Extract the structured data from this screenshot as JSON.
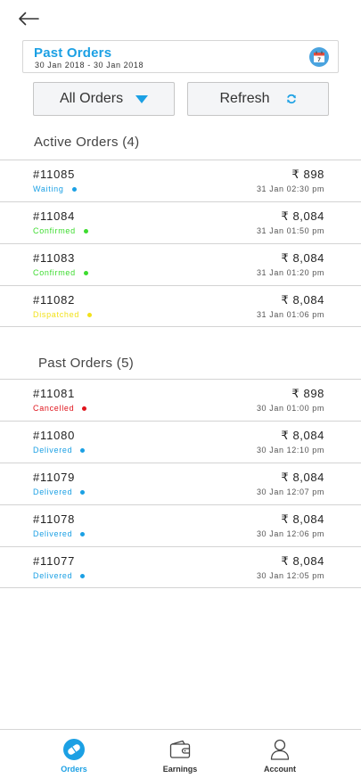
{
  "header": {
    "back_icon": "arrow-left-icon"
  },
  "date_filter": {
    "title": "Past Orders",
    "range": "30 Jan 2018 - 30 Jan 2018",
    "calendar_icon": "calendar-icon",
    "calendar_day": "7"
  },
  "controls": {
    "filter_label": "All Orders",
    "refresh_label": "Refresh"
  },
  "active_section": {
    "title": "Active Orders (4)",
    "orders": [
      {
        "id": "#11085",
        "status": "Waiting",
        "status_color": "#1ba0e4",
        "amount": "₹ 898",
        "time": "31 Jan 02:30 pm"
      },
      {
        "id": "#11084",
        "status": "Confirmed",
        "status_color": "#3ddc2f",
        "amount": "₹ 8,084",
        "time": "31 Jan 01:50 pm"
      },
      {
        "id": "#11083",
        "status": "Confirmed",
        "status_color": "#3ddc2f",
        "amount": "₹ 8,084",
        "time": "31 Jan 01:20 pm"
      },
      {
        "id": "#11082",
        "status": "Dispatched",
        "status_color": "#f2e11b",
        "amount": "₹ 8,084",
        "time": "31 Jan 01:06 pm"
      }
    ]
  },
  "past_section": {
    "title": "Past Orders (5)",
    "orders": [
      {
        "id": "#11081",
        "status": "Cancelled",
        "status_color": "#e0141c",
        "amount": "₹ 898",
        "time": "30 Jan 01:00 pm"
      },
      {
        "id": "#11080",
        "status": "Delivered",
        "status_color": "#1ba0e4",
        "amount": "₹ 8,084",
        "time": "30 Jan 12:10 pm"
      },
      {
        "id": "#11079",
        "status": "Delivered",
        "status_color": "#1ba0e4",
        "amount": "₹ 8,084",
        "time": "30 Jan 12:07 pm"
      },
      {
        "id": "#11078",
        "status": "Delivered",
        "status_color": "#1ba0e4",
        "amount": "₹ 8,084",
        "time": "30 Jan 12:06 pm"
      },
      {
        "id": "#11077",
        "status": "Delivered",
        "status_color": "#1ba0e4",
        "amount": "₹ 8,084",
        "time": "30 Jan 12:05 pm"
      }
    ]
  },
  "nav": {
    "items": [
      {
        "label": "Orders",
        "icon": "orders-icon",
        "active": true
      },
      {
        "label": "Earnings",
        "icon": "wallet-icon",
        "active": false
      },
      {
        "label": "Account",
        "icon": "user-icon",
        "active": false
      }
    ]
  },
  "colors": {
    "accent": "#1ba0e4",
    "text": "#222222",
    "divider": "#d3d3d3"
  }
}
